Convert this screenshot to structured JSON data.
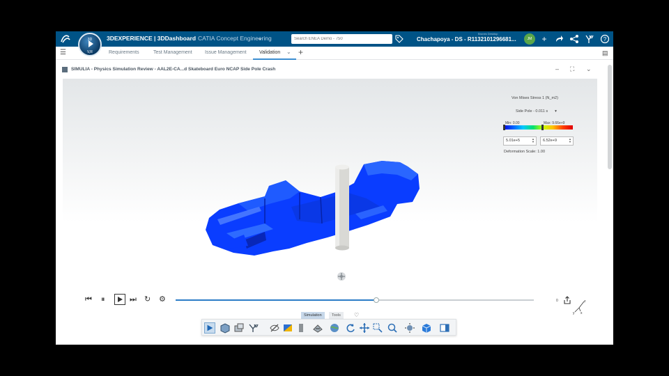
{
  "topbar": {
    "brand_name": "3DEXPERIENCE | 3DDashboard",
    "app_role": "CATIA Concept Engineering",
    "search_placeholder": "Search ENEA Demo - 750",
    "user_label": "Brunes Desktop",
    "user_name": "Chachapoya - DS - R1132101296681...",
    "avatar_initials": "JM",
    "compass_top": "3D",
    "compass_bottom": "V,R"
  },
  "tabs": [
    {
      "label": "Requirements"
    },
    {
      "label": "Test Management"
    },
    {
      "label": "Issue Management"
    },
    {
      "label": "Validation"
    }
  ],
  "widget": {
    "title": "SIMULIA - Physics Simulation Review - AAL2E-CA...d Skateboard Euro NCAP Side Pole Crash"
  },
  "legend": {
    "title": "Von Mises Stress 1 (N_m2)",
    "selection": "Side Pole - 0.011 s",
    "min_label": "Min: 0.00",
    "max_label": "Max: 9.66e+9",
    "lower_value": "5.01e+5",
    "upper_value": "6.52e+9",
    "deformation": "Deformation Scale: 1.00"
  },
  "playback": {
    "progress_percent": 56,
    "frame_value": "0"
  },
  "toolbar": {
    "tabs": [
      "Simulation",
      "Tools"
    ],
    "active_tab": "Simulation"
  },
  "colors": {
    "topbar": "#005386",
    "accent": "#3b8ed1",
    "model_blue": "#0a3dff",
    "pole": "#dcdcd8"
  }
}
